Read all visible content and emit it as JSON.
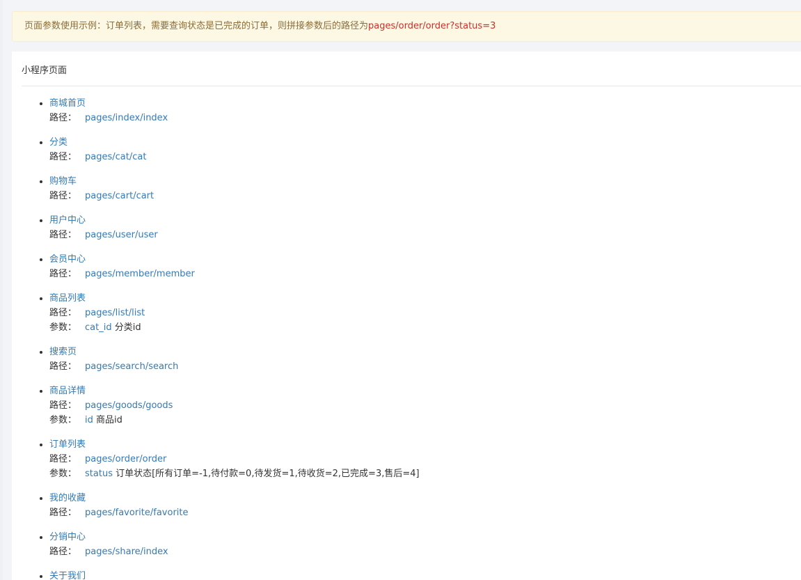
{
  "notice": {
    "prefix": "页面参数使用示例：订单列表，需要查询状态是已完成的订单，则拼接参数后的路径为",
    "example_path": "pages/order/order?status=3"
  },
  "panel": {
    "title": "小程序页面"
  },
  "labels": {
    "path": "路径：",
    "param": "参数："
  },
  "pages": [
    {
      "name": "商城首页",
      "path": "pages/index/index"
    },
    {
      "name": "分类",
      "path": "pages/cat/cat"
    },
    {
      "name": "购物车",
      "path": "pages/cart/cart"
    },
    {
      "name": "用户中心",
      "path": "pages/user/user"
    },
    {
      "name": "会员中心",
      "path": "pages/member/member"
    },
    {
      "name": "商品列表",
      "path": "pages/list/list",
      "param_key": "cat_id",
      "param_desc": "分类id"
    },
    {
      "name": "搜索页",
      "path": "pages/search/search"
    },
    {
      "name": "商品详情",
      "path": "pages/goods/goods",
      "param_key": "id",
      "param_desc": "商品id"
    },
    {
      "name": "订单列表",
      "path": "pages/order/order",
      "param_key": "status",
      "param_desc": "订单状态[所有订单=-1,待付款=0,待发货=1,待收货=2,已完成=3,售后=4]"
    },
    {
      "name": "我的收藏",
      "path": "pages/favorite/favorite"
    },
    {
      "name": "分销中心",
      "path": "pages/share/index"
    },
    {
      "name": "关于我们"
    }
  ]
}
